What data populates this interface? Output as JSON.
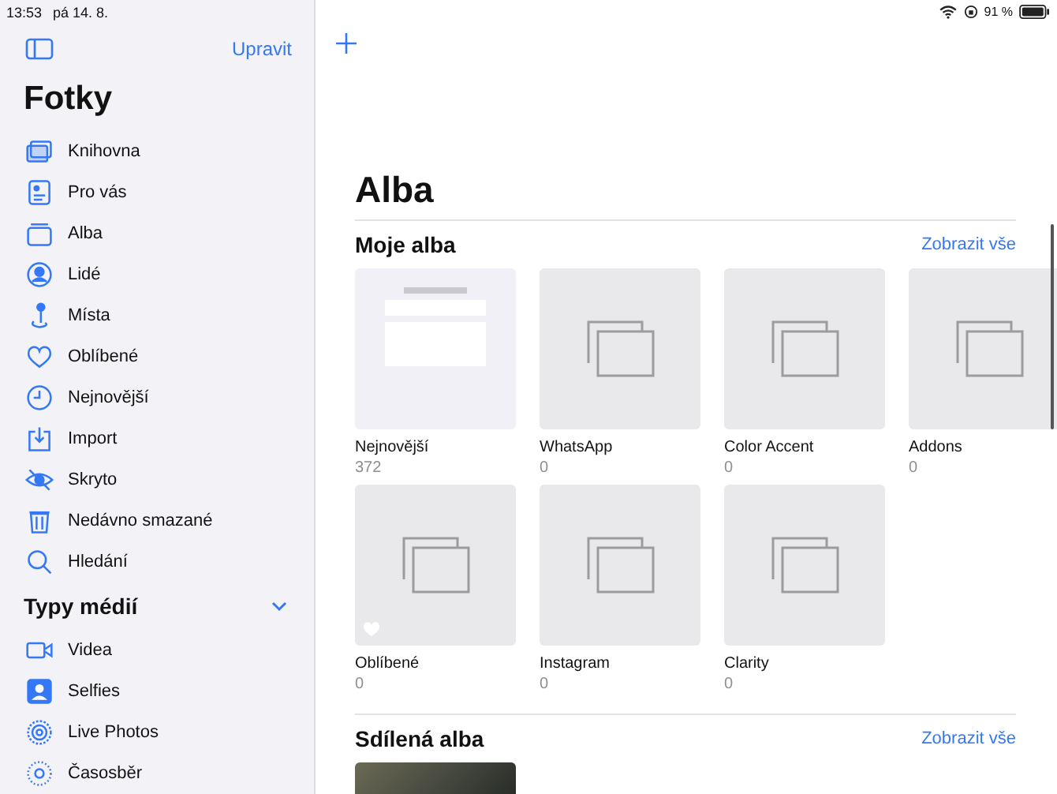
{
  "status_bar": {
    "time": "13:53",
    "date": "pá 14. 8.",
    "battery": "91 %"
  },
  "sidebar": {
    "edit_label": "Upravit",
    "title": "Fotky",
    "items": [
      {
        "label": "Knihovna"
      },
      {
        "label": "Pro vás"
      },
      {
        "label": "Alba"
      },
      {
        "label": "Lidé"
      },
      {
        "label": "Místa"
      },
      {
        "label": "Oblíbené"
      },
      {
        "label": "Nejnovější"
      },
      {
        "label": "Import"
      },
      {
        "label": "Skryto"
      },
      {
        "label": "Nedávno smazané"
      },
      {
        "label": "Hledání"
      }
    ],
    "section": {
      "title": "Typy médií",
      "expanded": true,
      "items": [
        {
          "label": "Videa"
        },
        {
          "label": "Selfies"
        },
        {
          "label": "Live Photos"
        },
        {
          "label": "Časosběr"
        }
      ]
    }
  },
  "main": {
    "title": "Alba",
    "sections": [
      {
        "title": "Moje alba",
        "link": "Zobrazit vše",
        "albums": [
          {
            "name": "Nejnovější",
            "count": "372",
            "kind": "screenshot",
            "favorite": false
          },
          {
            "name": "WhatsApp",
            "count": "0",
            "kind": "empty",
            "favorite": false
          },
          {
            "name": "Color Accent",
            "count": "0",
            "kind": "empty",
            "favorite": false
          },
          {
            "name": "Addons",
            "count": "0",
            "kind": "empty",
            "favorite": false
          },
          {
            "name": "Oblíbené",
            "count": "0",
            "kind": "empty",
            "favorite": true
          },
          {
            "name": "Instagram",
            "count": "0",
            "kind": "empty",
            "favorite": false
          },
          {
            "name": "Clarity",
            "count": "0",
            "kind": "empty",
            "favorite": false
          }
        ]
      },
      {
        "title": "Sdílená alba",
        "link": "Zobrazit vše",
        "albums": [
          {
            "kind": "photo"
          }
        ]
      }
    ]
  }
}
